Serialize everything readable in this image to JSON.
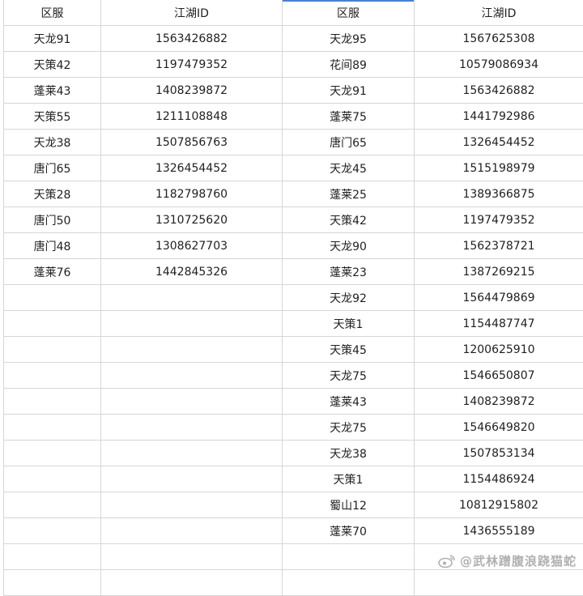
{
  "headers": [
    "区服",
    "江湖ID",
    "区服",
    "江湖ID"
  ],
  "rows": [
    [
      "天龙91",
      "1563426882",
      "天龙95",
      "1567625308"
    ],
    [
      "天策42",
      "1197479352",
      "花间89",
      "10579086934"
    ],
    [
      "蓬莱43",
      "1408239872",
      "天龙91",
      "1563426882"
    ],
    [
      "天策55",
      "1211108848",
      "蓬莱75",
      "1441792986"
    ],
    [
      "天龙38",
      "1507856763",
      "唐门65",
      "1326454452"
    ],
    [
      "唐门65",
      "1326454452",
      "天龙45",
      "1515198979"
    ],
    [
      "天策28",
      "1182798760",
      "蓬莱25",
      "1389366875"
    ],
    [
      "唐门50",
      "1310725620",
      "天策42",
      "1197479352"
    ],
    [
      "唐门48",
      "1308627703",
      "天龙90",
      "1562378721"
    ],
    [
      "蓬莱76",
      "1442845326",
      "蓬莱23",
      "1387269215"
    ],
    [
      "",
      "",
      "天龙92",
      "1564479869"
    ],
    [
      "",
      "",
      "天策1",
      "1154487747"
    ],
    [
      "",
      "",
      "天策45",
      "1200625910"
    ],
    [
      "",
      "",
      "天龙75",
      "1546650807"
    ],
    [
      "",
      "",
      "蓬莱43",
      "1408239872"
    ],
    [
      "",
      "",
      "天龙75",
      "1546649820"
    ],
    [
      "",
      "",
      "天龙38",
      "1507853134"
    ],
    [
      "",
      "",
      "天策1",
      "1154486924"
    ],
    [
      "",
      "",
      "蜀山12",
      "10812915802"
    ],
    [
      "",
      "",
      "蓬莱70",
      "1436555189"
    ],
    [
      "",
      "",
      "",
      ""
    ],
    [
      "",
      "",
      "",
      ""
    ]
  ],
  "watermark": {
    "text": "@武林蹭腹浪跷猫蛇",
    "icon": "weibo-icon"
  }
}
